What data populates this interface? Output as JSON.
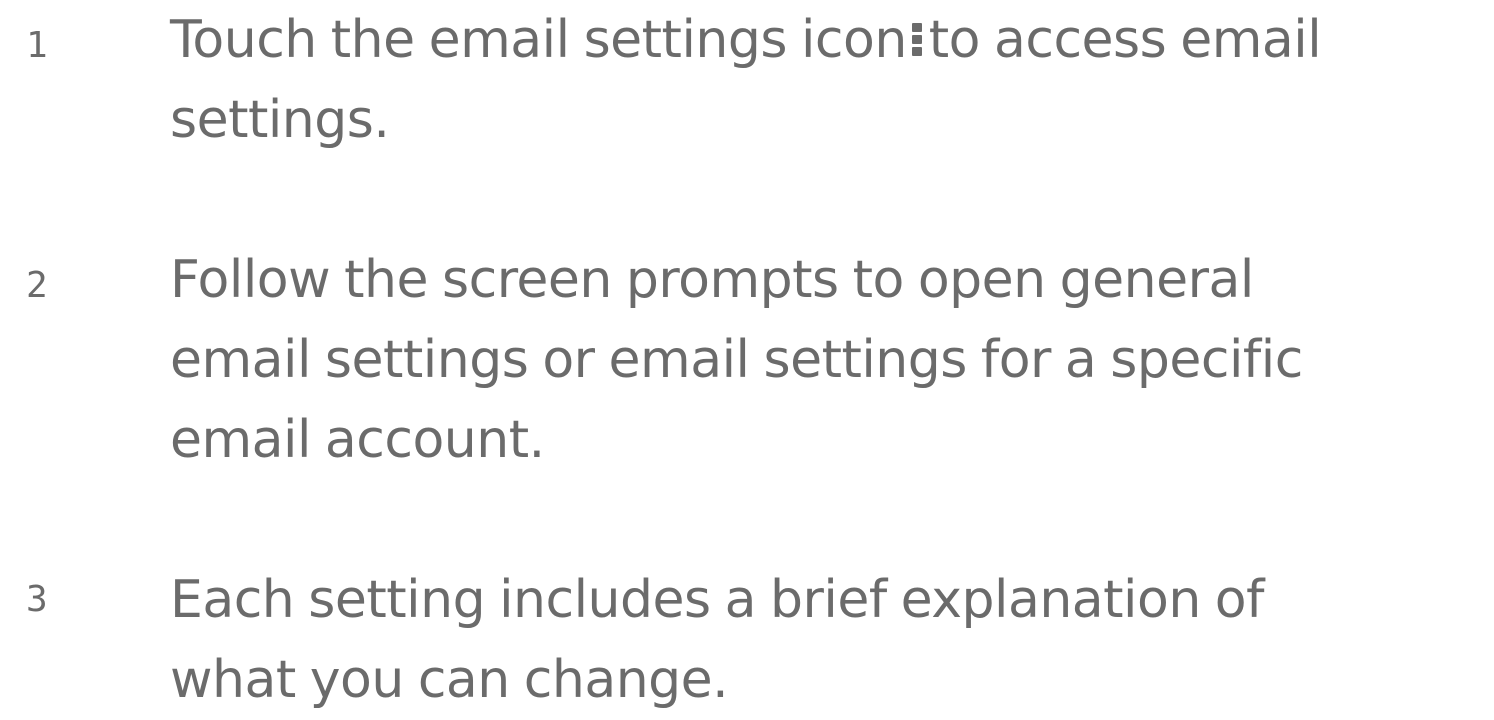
{
  "steps": [
    {
      "number": "1",
      "text_before_icon": "Touch the email settings icon",
      "icon": "vertical-dots-menu-icon",
      "text_after_icon": "to access email",
      "line_2": "settings."
    },
    {
      "number": "2",
      "line_1": "Follow the screen prompts to open general",
      "line_2": "email settings or email settings for a specific",
      "line_3": "email account."
    },
    {
      "number": "3",
      "line_1": "Each setting includes a brief explanation of",
      "line_2": "what you can change."
    }
  ],
  "colors": {
    "text": "#6b6b6b",
    "background": "#ffffff"
  }
}
